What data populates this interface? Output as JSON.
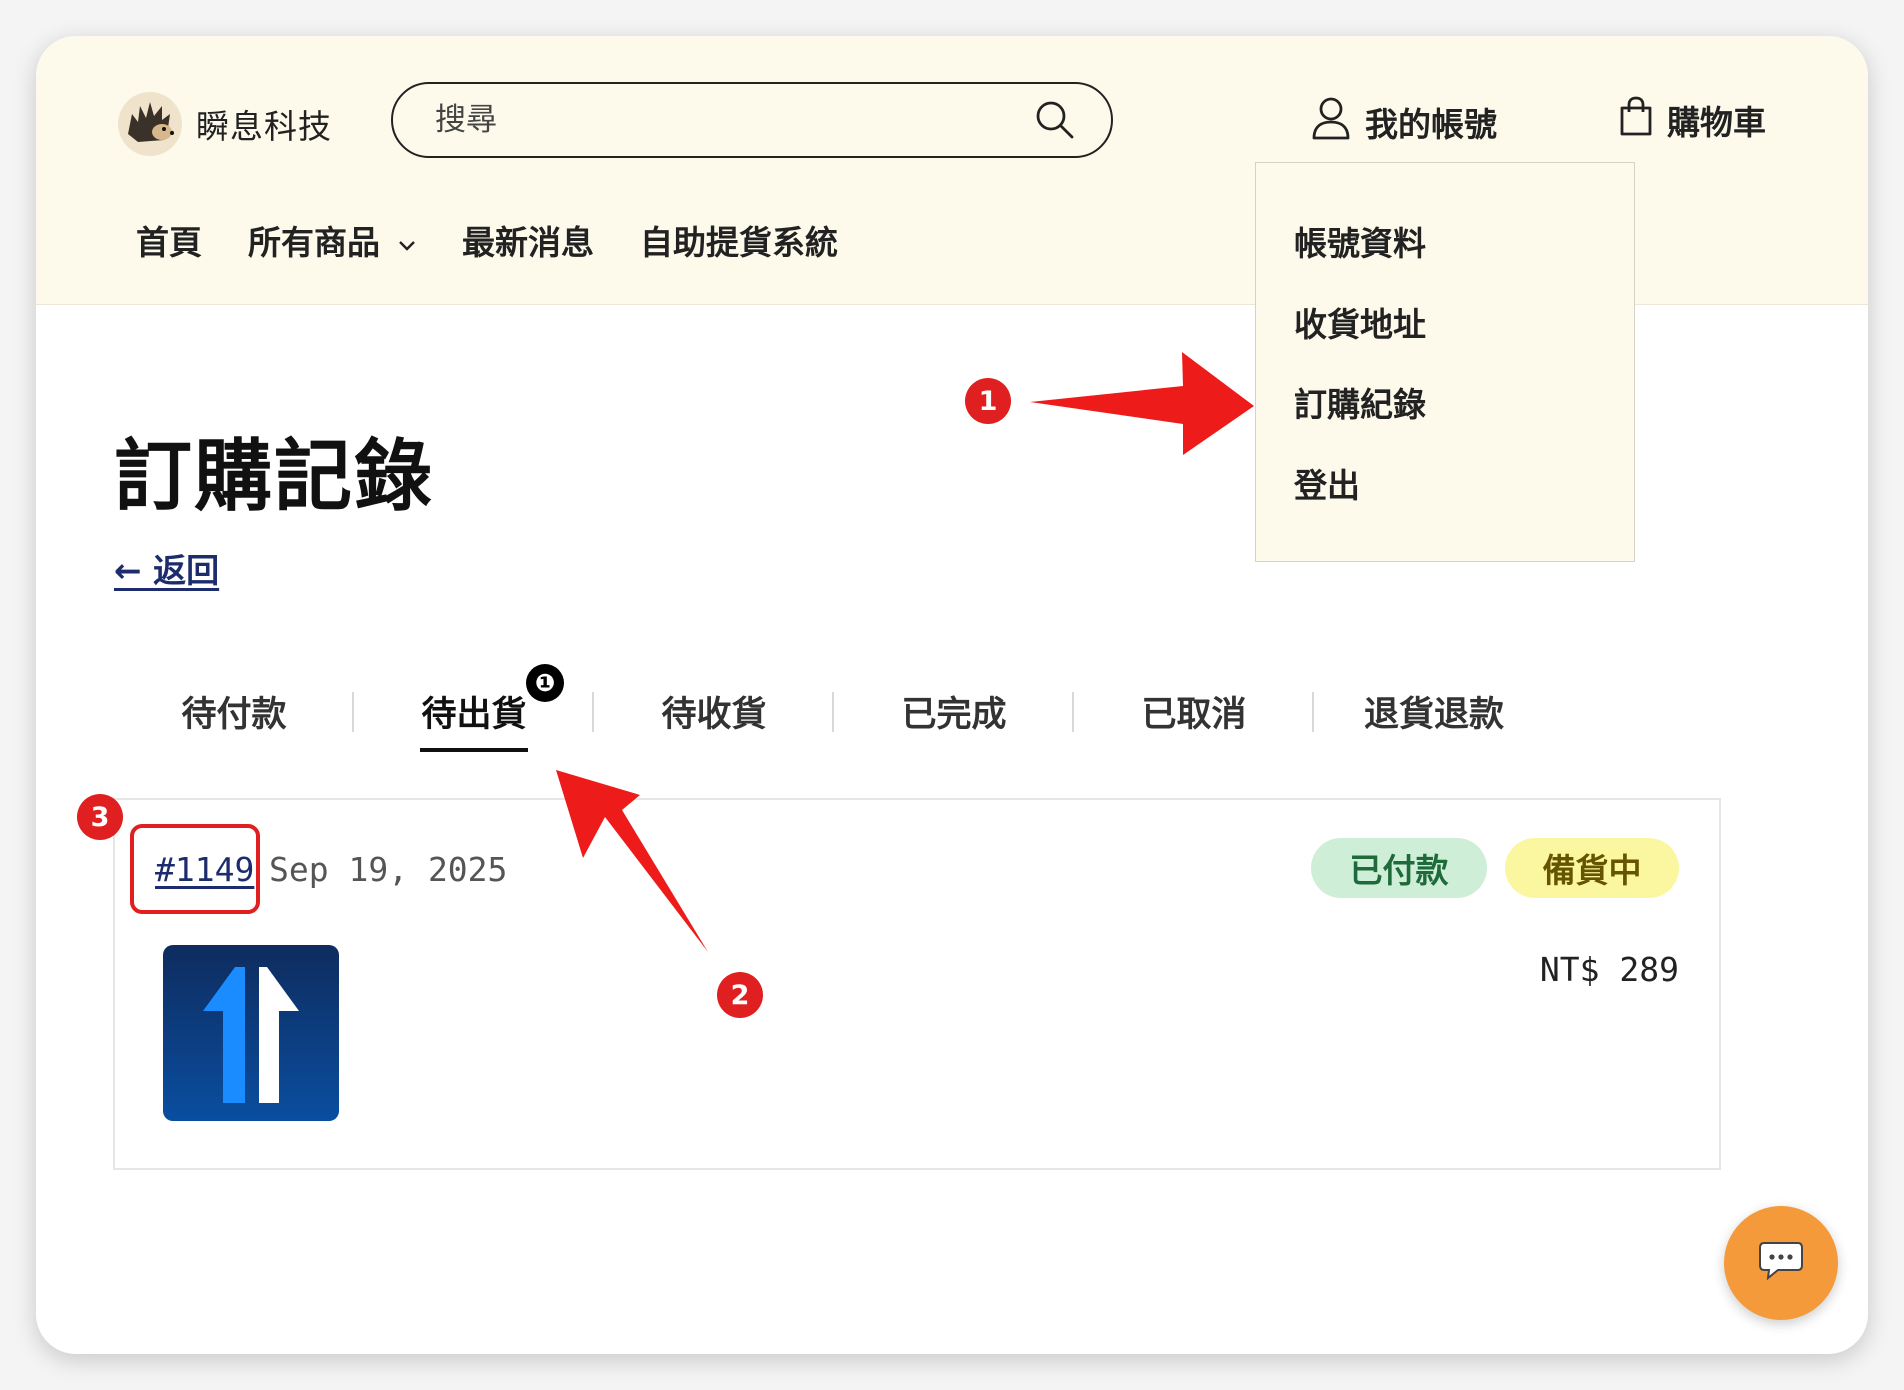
{
  "header": {
    "brand": "瞬息科技",
    "search_placeholder": "搜尋",
    "account_label": "我的帳號",
    "cart_label": "購物車",
    "nav": [
      "首頁",
      "所有商品",
      "最新消息",
      "自助提貨系統"
    ]
  },
  "dropdown": {
    "items": [
      "帳號資料",
      "收貨地址",
      "訂購紀錄",
      "登出"
    ]
  },
  "page": {
    "title": "訂購記錄",
    "back_label": "← 返回"
  },
  "tabs": {
    "items": [
      "待付款",
      "待出貨",
      "待收貨",
      "已完成",
      "已取消",
      "退貨退款"
    ],
    "active": "待出貨",
    "badge": "❶"
  },
  "order": {
    "id": "#1149",
    "date": "Sep 19, 2025",
    "payment_status": "已付款",
    "fulfillment_status": "備貨中",
    "price": "NT$ 289"
  },
  "annotations": {
    "step1": "1",
    "step2": "2",
    "step3": "3"
  },
  "colors": {
    "header_bg": "#fdfaec",
    "annotation_red": "#e02020",
    "chat_orange": "#f59a3b",
    "link_navy": "#1c2c6c"
  }
}
